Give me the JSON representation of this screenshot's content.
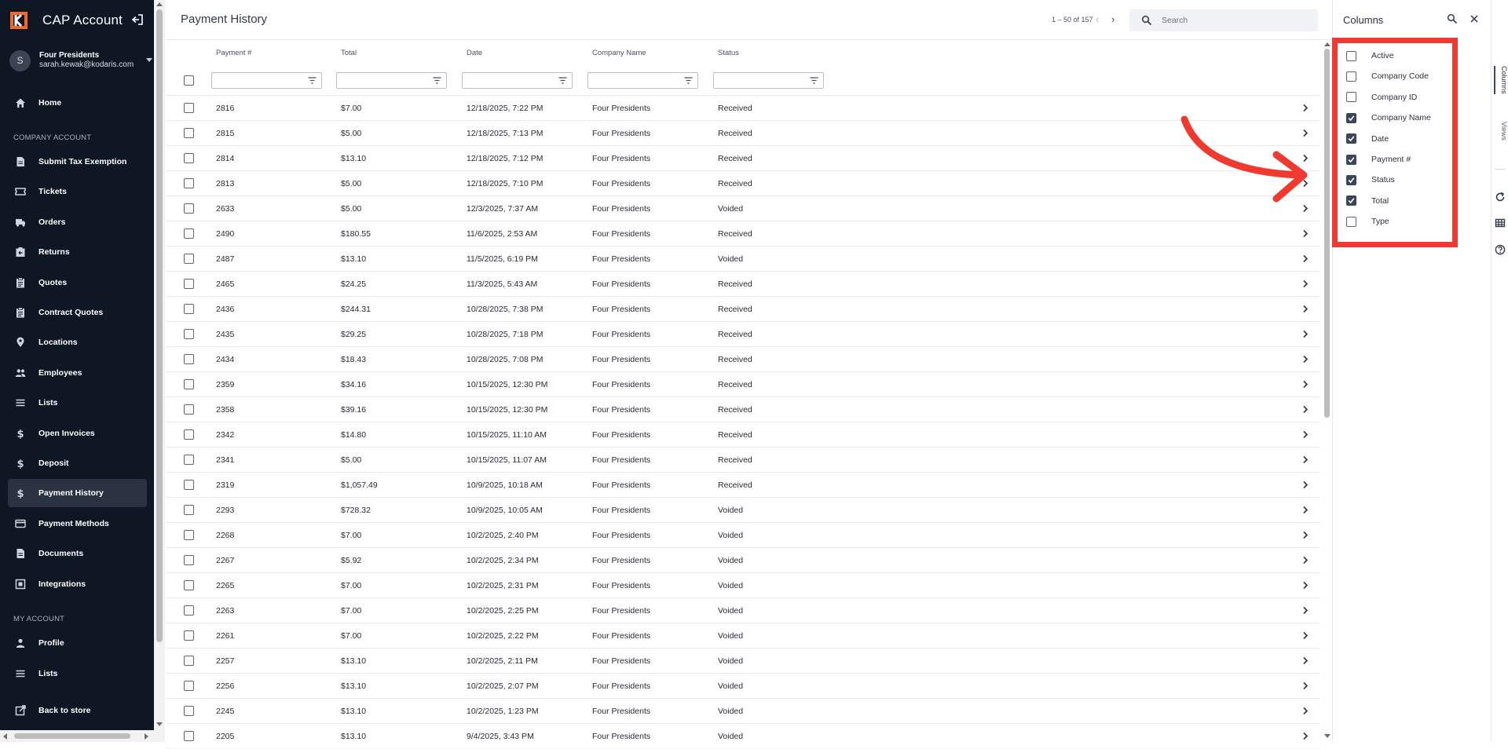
{
  "app": {
    "title": "CAP Account"
  },
  "user": {
    "avatar_initial": "S",
    "company": "Four Presidents",
    "email": "sarah.kewak@kodaris.com"
  },
  "nav": {
    "home": "Home",
    "section_company": "COMPANY ACCOUNT",
    "company_items": [
      {
        "label": "Submit Tax Exemption",
        "icon": "document-icon"
      },
      {
        "label": "Tickets",
        "icon": "ticket-icon"
      },
      {
        "label": "Orders",
        "icon": "truck-icon"
      },
      {
        "label": "Returns",
        "icon": "return-icon"
      },
      {
        "label": "Quotes",
        "icon": "clipboard-icon"
      },
      {
        "label": "Contract Quotes",
        "icon": "clipboard-icon"
      },
      {
        "label": "Locations",
        "icon": "location-pin-icon"
      },
      {
        "label": "Employees",
        "icon": "people-icon"
      },
      {
        "label": "Lists",
        "icon": "list-icon"
      },
      {
        "label": "Open Invoices",
        "icon": "dollar-icon"
      },
      {
        "label": "Deposit",
        "icon": "dollar-icon"
      },
      {
        "label": "Payment History",
        "icon": "dollar-icon"
      },
      {
        "label": "Payment Methods",
        "icon": "credit-card-icon"
      },
      {
        "label": "Documents",
        "icon": "document-icon"
      },
      {
        "label": "Integrations",
        "icon": "integration-icon"
      }
    ],
    "active": "Payment History",
    "section_my": "MY ACCOUNT",
    "my_items": [
      {
        "label": "Profile",
        "icon": "person-icon"
      },
      {
        "label": "Lists",
        "icon": "list-icon"
      }
    ],
    "back": "Back to store"
  },
  "page": {
    "title": "Payment History",
    "pager": "1 – 50 of 157",
    "search_placeholder": "Search"
  },
  "table": {
    "columns": [
      "Payment #",
      "Total",
      "Date",
      "Company Name",
      "Status"
    ],
    "rows": [
      [
        "2816",
        "$7.00",
        "12/18/2025, 7:22 PM",
        "Four Presidents",
        "Received"
      ],
      [
        "2815",
        "$5.00",
        "12/18/2025, 7:13 PM",
        "Four Presidents",
        "Received"
      ],
      [
        "2814",
        "$13.10",
        "12/18/2025, 7:12 PM",
        "Four Presidents",
        "Received"
      ],
      [
        "2813",
        "$5.00",
        "12/18/2025, 7:10 PM",
        "Four Presidents",
        "Received"
      ],
      [
        "2633",
        "$5.00",
        "12/3/2025, 7:37 AM",
        "Four Presidents",
        "Voided"
      ],
      [
        "2490",
        "$180.55",
        "11/6/2025, 2:53 AM",
        "Four Presidents",
        "Received"
      ],
      [
        "2487",
        "$13.10",
        "11/5/2025, 6:19 PM",
        "Four Presidents",
        "Voided"
      ],
      [
        "2465",
        "$24.25",
        "11/3/2025, 5:43 AM",
        "Four Presidents",
        "Received"
      ],
      [
        "2436",
        "$244.31",
        "10/28/2025, 7:38 PM",
        "Four Presidents",
        "Received"
      ],
      [
        "2435",
        "$29.25",
        "10/28/2025, 7:18 PM",
        "Four Presidents",
        "Received"
      ],
      [
        "2434",
        "$18.43",
        "10/28/2025, 7:08 PM",
        "Four Presidents",
        "Received"
      ],
      [
        "2359",
        "$34.16",
        "10/15/2025, 12:30 PM",
        "Four Presidents",
        "Received"
      ],
      [
        "2358",
        "$39.16",
        "10/15/2025, 12:30 PM",
        "Four Presidents",
        "Received"
      ],
      [
        "2342",
        "$14.80",
        "10/15/2025, 11:10 AM",
        "Four Presidents",
        "Received"
      ],
      [
        "2341",
        "$5.00",
        "10/15/2025, 11:07 AM",
        "Four Presidents",
        "Received"
      ],
      [
        "2319",
        "$1,057.49",
        "10/9/2025, 10:18 AM",
        "Four Presidents",
        "Received"
      ],
      [
        "2293",
        "$728.32",
        "10/9/2025, 10:05 AM",
        "Four Presidents",
        "Voided"
      ],
      [
        "2268",
        "$7.00",
        "10/2/2025, 2:40 PM",
        "Four Presidents",
        "Voided"
      ],
      [
        "2267",
        "$5.92",
        "10/2/2025, 2:34 PM",
        "Four Presidents",
        "Voided"
      ],
      [
        "2265",
        "$7.00",
        "10/2/2025, 2:31 PM",
        "Four Presidents",
        "Voided"
      ],
      [
        "2263",
        "$7.00",
        "10/2/2025, 2:25 PM",
        "Four Presidents",
        "Voided"
      ],
      [
        "2261",
        "$7.00",
        "10/2/2025, 2:22 PM",
        "Four Presidents",
        "Voided"
      ],
      [
        "2257",
        "$13.10",
        "10/2/2025, 2:11 PM",
        "Four Presidents",
        "Voided"
      ],
      [
        "2256",
        "$13.10",
        "10/2/2025, 2:07 PM",
        "Four Presidents",
        "Voided"
      ],
      [
        "2245",
        "$13.10",
        "10/2/2025, 1:23 PM",
        "Four Presidents",
        "Voided"
      ],
      [
        "2205",
        "$13.10",
        "9/4/2025, 3:43 PM",
        "Four Presidents",
        "Voided"
      ]
    ]
  },
  "columns_panel": {
    "title": "Columns",
    "options": [
      {
        "label": "Active",
        "checked": false
      },
      {
        "label": "Company Code",
        "checked": false
      },
      {
        "label": "Company ID",
        "checked": false
      },
      {
        "label": "Company Name",
        "checked": true
      },
      {
        "label": "Date",
        "checked": true
      },
      {
        "label": "Payment #",
        "checked": true
      },
      {
        "label": "Status",
        "checked": true
      },
      {
        "label": "Total",
        "checked": true
      },
      {
        "label": "Type",
        "checked": false
      }
    ]
  },
  "side_tabs": {
    "columns": "Columns",
    "views": "Views"
  },
  "colors": {
    "sidebar_bg": "#0f1624",
    "annotation_red": "#f03a30",
    "checkbox_checked": "#3c4658",
    "brand_orange": "#f26a21"
  }
}
